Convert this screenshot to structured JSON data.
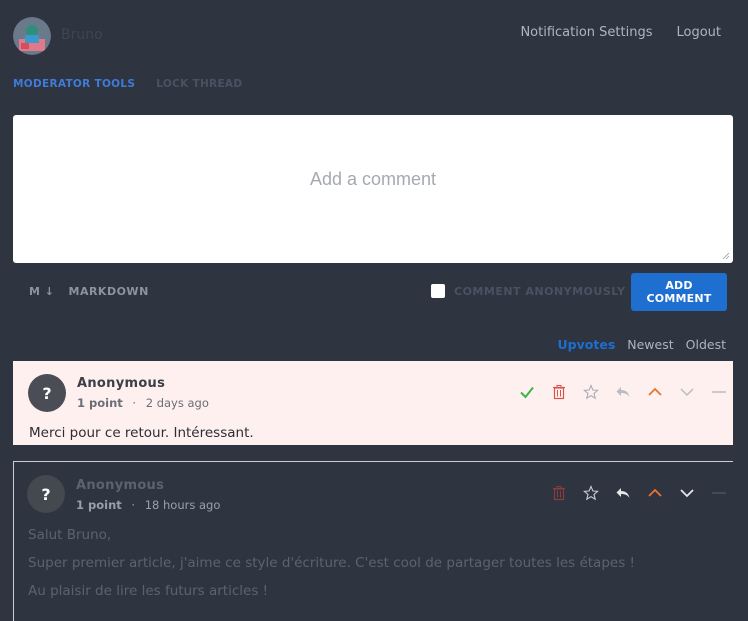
{
  "header": {
    "username": "Bruno",
    "links": {
      "notifications": "Notification Settings",
      "logout": "Logout"
    }
  },
  "moderator": {
    "tools_label": "MODERATOR TOOLS",
    "lock_label": "LOCK THREAD"
  },
  "composer": {
    "placeholder": "Add a comment",
    "markdown_icon": "M ↓",
    "markdown_label": "MARKDOWN",
    "anonymous_label": "COMMENT ANONYMOUSLY",
    "anonymous_checked": false,
    "submit_label": "ADD COMMENT"
  },
  "sort": {
    "upvotes": "Upvotes",
    "newest": "Newest",
    "oldest": "Oldest",
    "active": "Upvotes"
  },
  "comments": [
    {
      "author": "Anonymous",
      "avatar_glyph": "?",
      "points": "1 point",
      "separator": "·",
      "time": "2 days ago",
      "lines": [
        "Merci pour ce retour. Intéressant."
      ],
      "icons": [
        "check-icon",
        "trash-icon",
        "star-icon",
        "reply-icon",
        "upvote-icon",
        "downvote-icon",
        "collapse-icon"
      ]
    },
    {
      "author": "Anonymous",
      "avatar_glyph": "?",
      "points": "1 point",
      "separator": "·",
      "time": "18 hours ago",
      "lines": [
        "Salut Bruno,",
        "Super premier article, j'aime ce style d'écriture. C'est cool de partager toutes les étapes !",
        "Au plaisir de lire les futurs articles !"
      ],
      "icons": [
        "trash-icon",
        "star-icon",
        "reply-icon",
        "upvote-icon",
        "downvote-icon",
        "collapse-icon"
      ]
    }
  ],
  "colors": {
    "background": "#2e3440",
    "accent": "#1e6fcf",
    "pending_bg": "#fef0ef",
    "approve": "#3bb54a",
    "delete": "#d9534f",
    "upvote": "#e8742e"
  }
}
